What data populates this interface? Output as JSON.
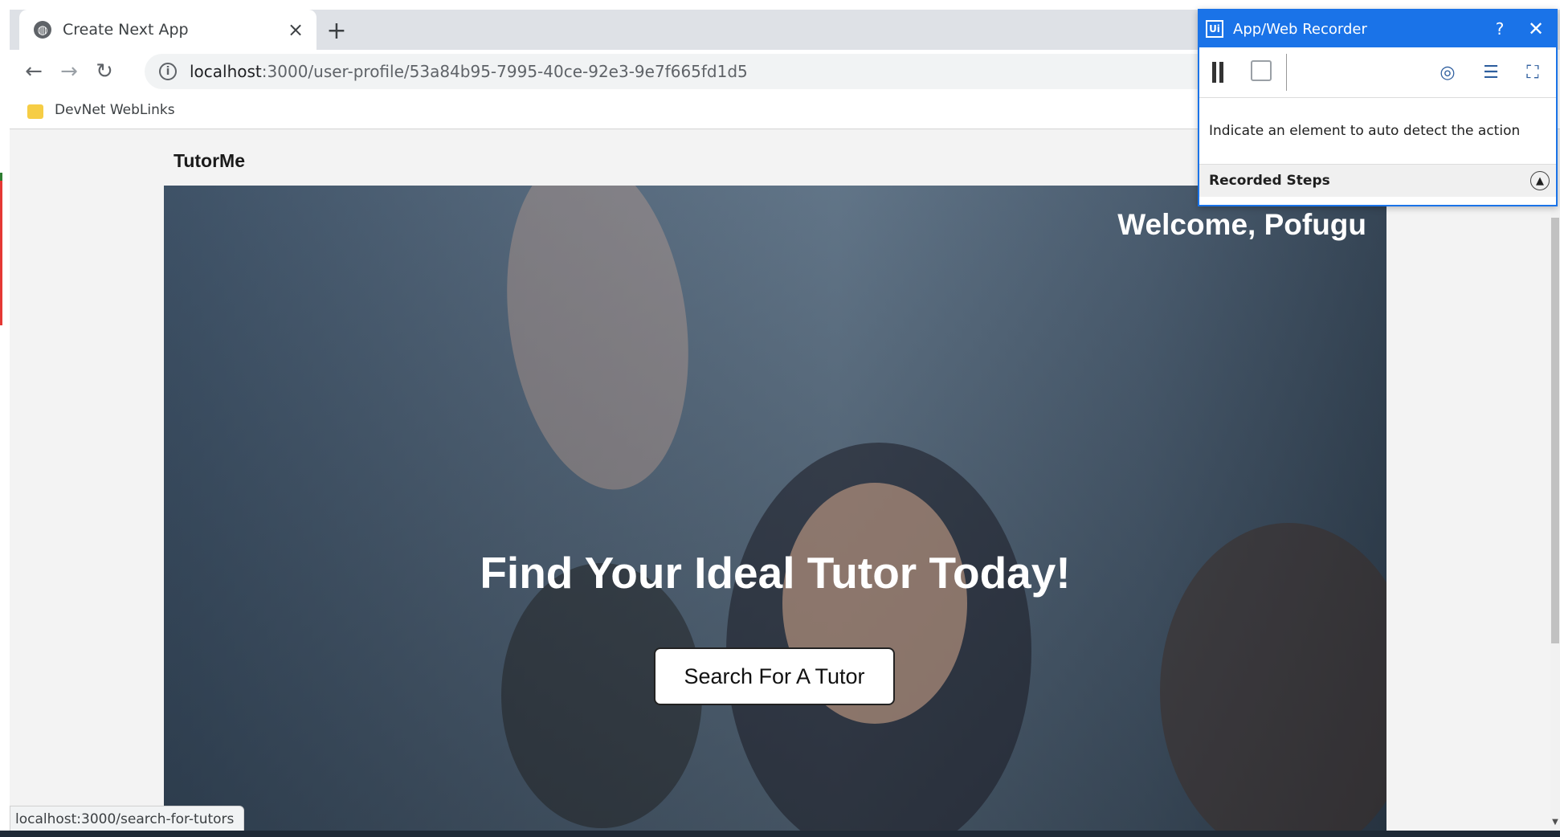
{
  "browser": {
    "tab_title": "Create Next App",
    "new_tab_symbol": "+",
    "url_host": "localhost",
    "url_path": ":3000/user-profile/53a84b95-7995-40ce-92e3-9e7f665fd1d5",
    "bookmark_label": "DevNet WebLinks",
    "status_url": "localhost:3000/search-for-tutors"
  },
  "page": {
    "brand": "TutorMe",
    "welcome": "Welcome, Pofugu",
    "hero_title": "Find Your Ideal Tutor Today!",
    "search_button": "Search For A Tutor"
  },
  "recorder": {
    "title": "App/Web Recorder",
    "help": "?",
    "hint": "Indicate an element to auto detect the action",
    "steps_label": "Recorded Steps"
  },
  "colors": {
    "recorder_accent": "#1a73e8",
    "hero_overlay": "#3d4d5e"
  }
}
